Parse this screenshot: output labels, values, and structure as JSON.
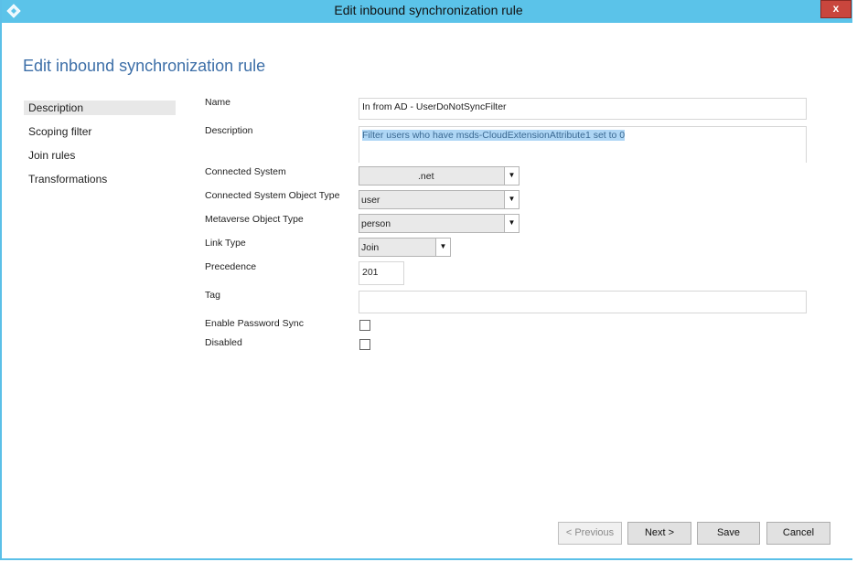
{
  "window": {
    "title": "Edit inbound synchronization rule",
    "close_label": "x"
  },
  "page": {
    "heading": "Edit inbound synchronization rule"
  },
  "nav": {
    "items": [
      {
        "label": "Description",
        "selected": true
      },
      {
        "label": "Scoping filter",
        "selected": false
      },
      {
        "label": "Join rules",
        "selected": false
      },
      {
        "label": "Transformations",
        "selected": false
      }
    ]
  },
  "form": {
    "name": {
      "label": "Name",
      "value": "In from AD - UserDoNotSyncFilter"
    },
    "description": {
      "label": "Description",
      "value": "Filter users who have msds-CloudExtensionAttribute1 set to 0"
    },
    "connected_system": {
      "label": "Connected System",
      "value": ".net"
    },
    "connected_system_object_type": {
      "label": "Connected System Object Type",
      "value": "user"
    },
    "metaverse_object_type": {
      "label": "Metaverse Object Type",
      "value": "person"
    },
    "link_type": {
      "label": "Link Type",
      "value": "Join"
    },
    "precedence": {
      "label": "Precedence",
      "value": "201"
    },
    "tag": {
      "label": "Tag",
      "value": ""
    },
    "enable_password_sync": {
      "label": "Enable Password Sync",
      "checked": false
    },
    "disabled": {
      "label": "Disabled",
      "checked": false
    }
  },
  "buttons": {
    "previous": "< Previous",
    "next": "Next >",
    "save": "Save",
    "cancel": "Cancel"
  },
  "colors": {
    "titlebar": "#5bc3e9",
    "heading": "#3d6fa8",
    "close": "#c9463d",
    "selection": "#aed6f5"
  }
}
